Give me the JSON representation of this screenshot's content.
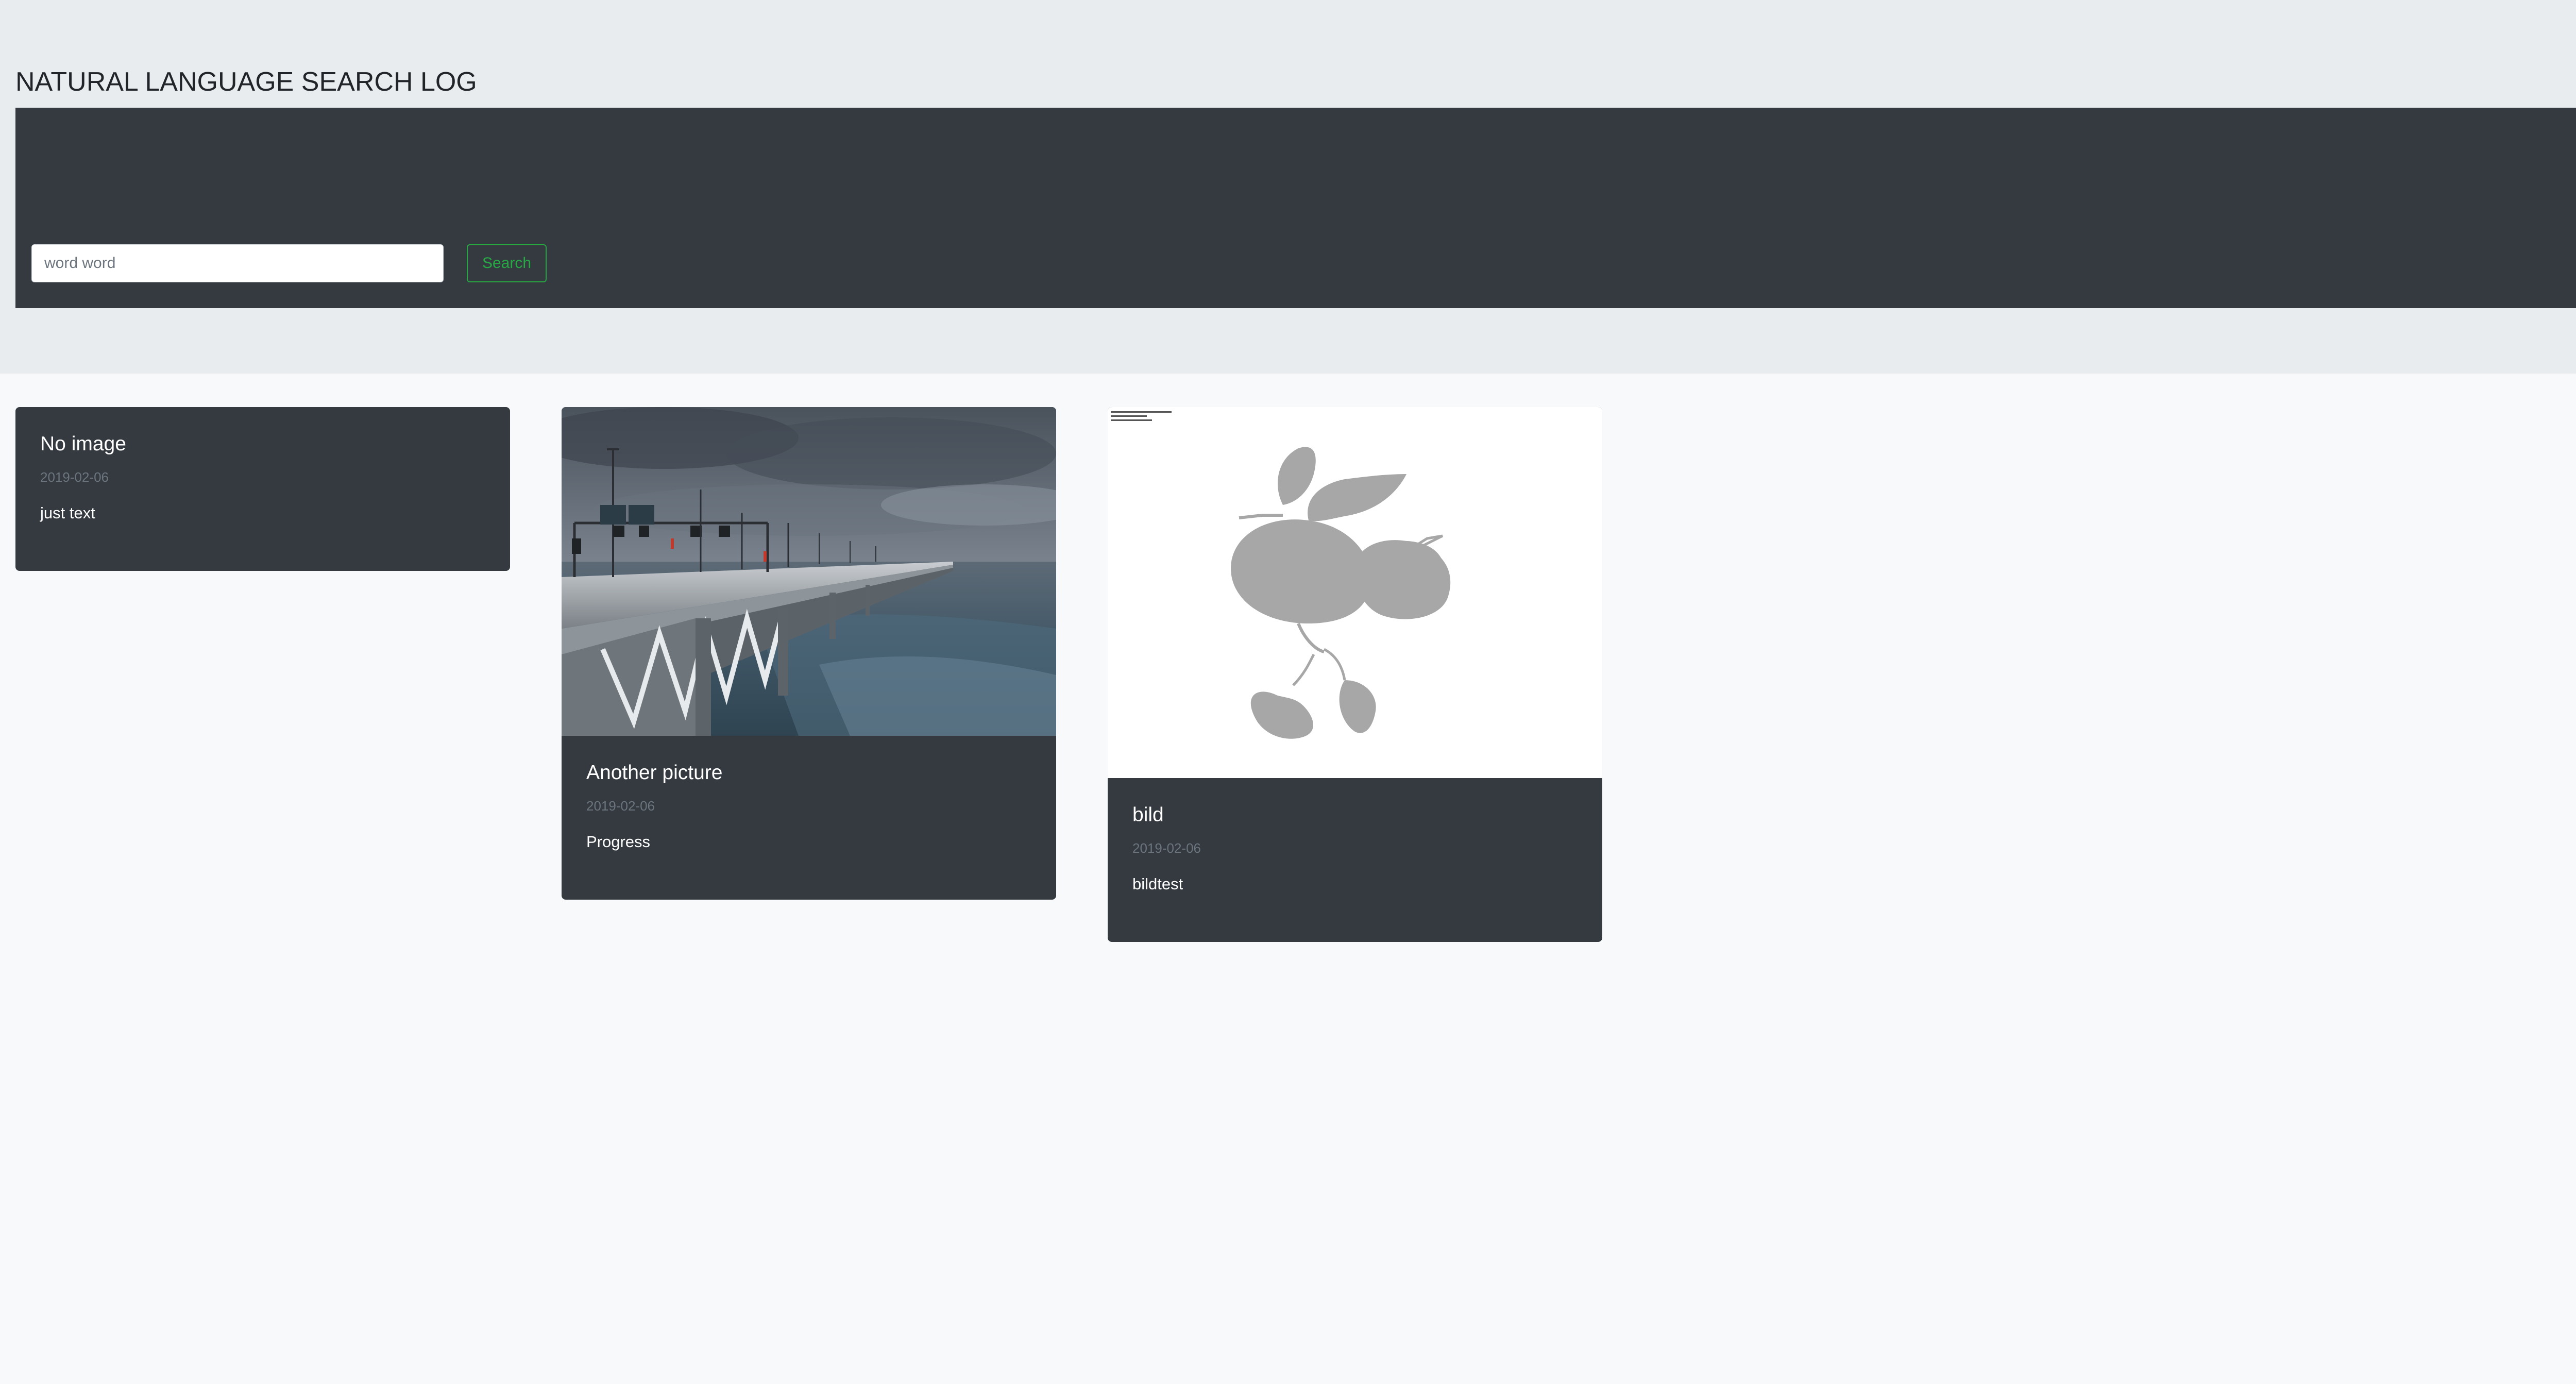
{
  "header": {
    "title": "NATURAL LANGUAGE SEARCH LOG"
  },
  "search": {
    "placeholder": "word word",
    "button_label": "Search"
  },
  "cards": [
    {
      "title": "No image",
      "date": "2019-02-06",
      "text": "just text",
      "has_image": false
    },
    {
      "title": "Another picture",
      "date": "2019-02-06",
      "text": "Progress",
      "has_image": true,
      "image_subject": "bridge-over-sea-photo"
    },
    {
      "title": "bild",
      "date": "2019-02-06",
      "text": "bildtest",
      "has_image": true,
      "image_subject": "fruit-branch-silhouette"
    }
  ],
  "colors": {
    "jumbotron_bg": "#e9ecef",
    "page_bg": "#f8f9fa",
    "panel_bg": "#343a40",
    "accent_green": "#28a745",
    "muted_text": "#6c757d"
  }
}
